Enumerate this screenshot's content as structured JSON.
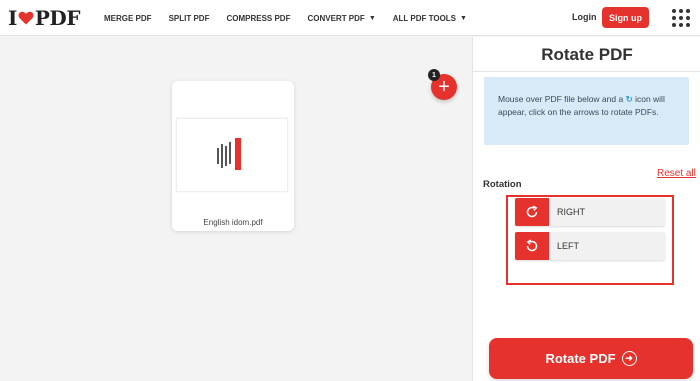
{
  "logo": {
    "left": "I",
    "right": "PDF",
    "heart_color": "#e5322d"
  },
  "nav": [
    {
      "label": "MERGE PDF"
    },
    {
      "label": "SPLIT PDF"
    },
    {
      "label": "COMPRESS PDF"
    },
    {
      "label": "CONVERT PDF"
    },
    {
      "label": "ALL PDF TOOLS"
    }
  ],
  "header": {
    "login": "Login",
    "signup": "Sign up"
  },
  "workspace": {
    "file_name": "English idom.pdf",
    "file_count": "1",
    "add_label": "+"
  },
  "sidebar": {
    "title": "Rotate PDF",
    "info_text_1": "Mouse over PDF file below and a",
    "info_icon": "↻",
    "info_text_2": "icon will appear, click on the arrows to rotate PDFs.",
    "reset_all": "Reset all",
    "rotation_label": "Rotation",
    "right_label": "RIGHT",
    "left_label": "LEFT",
    "cta": "Rotate PDF"
  },
  "colors": {
    "accent": "#e5322d",
    "info_bg": "#d8eaf8"
  }
}
